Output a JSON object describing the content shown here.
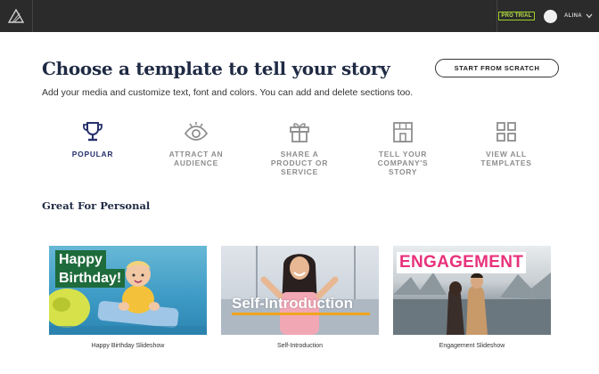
{
  "topbar": {
    "logo_icon": "triangle-logo-icon",
    "pro_badge": "PRO TRIAL",
    "user_name": "ALINA",
    "accent": "#9fcf2d"
  },
  "header": {
    "title": "Choose a template to tell your story",
    "subtitle": "Add your media and customize text, font and colors. You can add and delete sections too.",
    "scratch_button": "START FROM SCRATCH"
  },
  "categories": [
    {
      "label": "POPULAR",
      "icon": "trophy-icon",
      "active": true
    },
    {
      "label": "ATTRACT AN\nAUDIENCE",
      "icon": "eye-icon",
      "active": false
    },
    {
      "label": "SHARE A\nPRODUCT OR\nSERVICE",
      "icon": "gift-icon",
      "active": false
    },
    {
      "label": "TELL YOUR\nCOMPANY'S\nSTORY",
      "icon": "storefront-icon",
      "active": false
    },
    {
      "label": "VIEW ALL\nTEMPLATES",
      "icon": "grid-icon",
      "active": false
    }
  ],
  "section": {
    "title": "Great For Personal"
  },
  "cards": [
    {
      "caption": "Happy Birthday Slideshow",
      "overlay_line1": "Happy",
      "overlay_line2": "Birthday!",
      "overlay_bg": "#1e6b3c"
    },
    {
      "caption": "Self-Introduction",
      "overlay": "Self-Introduction",
      "underline": "#f0a51e"
    },
    {
      "caption": "Engagement Slideshow",
      "overlay": "ENGAGEMENT",
      "overlay_color": "#e8327c"
    }
  ]
}
